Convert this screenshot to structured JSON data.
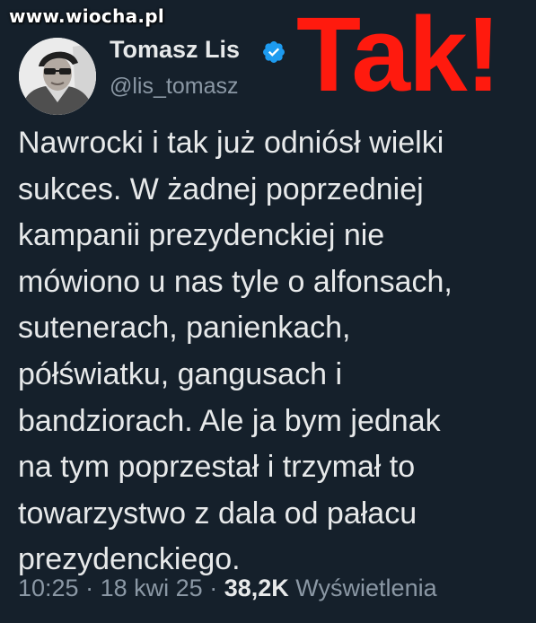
{
  "watermark": {
    "text": "www.wiocha.pl"
  },
  "stamp": {
    "text": "Tak!",
    "color": "#ff1a0e"
  },
  "tweet": {
    "author": {
      "display_name": "Tomasz Lis",
      "handle": "@lis_tomasz",
      "verified": true,
      "verified_icon": "verified-badge-icon",
      "verified_color": "#1d9bf0"
    },
    "text_lines": [
      "Nawrocki i tak już odniósł wielki",
      "sukces. W żadnej poprzedniej",
      "kampanii prezydenckiej nie",
      "mówiono u nas tyle o alfonsach,",
      "sutenerach, panienkach,",
      "półświatku, gangusach i",
      "bandziorach. Ale ja bym jednak",
      "na tym poprzestał i trzymał to",
      "towarzystwo z dala od pałacu",
      "prezydenckiego."
    ],
    "time": "10:25",
    "separator": "·",
    "date": "18 kwi 25",
    "views_count": "38,2K",
    "views_label": "Wyświetlenia"
  },
  "theme": {
    "background": "#15202b",
    "text_primary": "#e7e9ea",
    "text_secondary": "#8b98a5"
  }
}
